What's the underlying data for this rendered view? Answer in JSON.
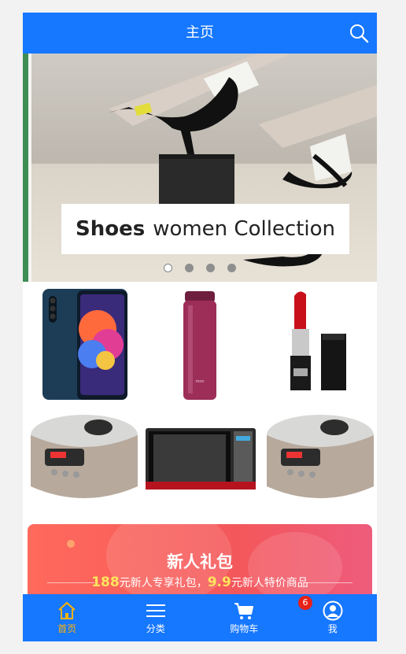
{
  "header": {
    "title": "主页"
  },
  "banner": {
    "caption_bold": "Shoes",
    "caption_rest": "women Collection",
    "slides_total": 4,
    "active_slide": 1
  },
  "products": [
    {
      "name": "phone"
    },
    {
      "name": "thermos-bottle"
    },
    {
      "name": "lipstick"
    },
    {
      "name": "rice-cooker"
    },
    {
      "name": "microwave"
    },
    {
      "name": "rice-cooker"
    }
  ],
  "promo": {
    "headline": "新人礼包",
    "amount1": "188",
    "text1": "元新人专享礼包，",
    "amount2": "9.9",
    "text2": "元新人特价商品"
  },
  "tabs": [
    {
      "label": "首页",
      "icon": "home-icon",
      "active": true
    },
    {
      "label": "分类",
      "icon": "menu-icon",
      "active": false
    },
    {
      "label": "购物车",
      "icon": "cart-icon",
      "active": false,
      "badge": "6"
    },
    {
      "label": "我",
      "icon": "user-icon",
      "active": false
    }
  ],
  "colors": {
    "primary": "#1677ff",
    "active_tab": "#ffb300",
    "badge": "#e62117",
    "promo_highlight": "#ffe45c"
  }
}
